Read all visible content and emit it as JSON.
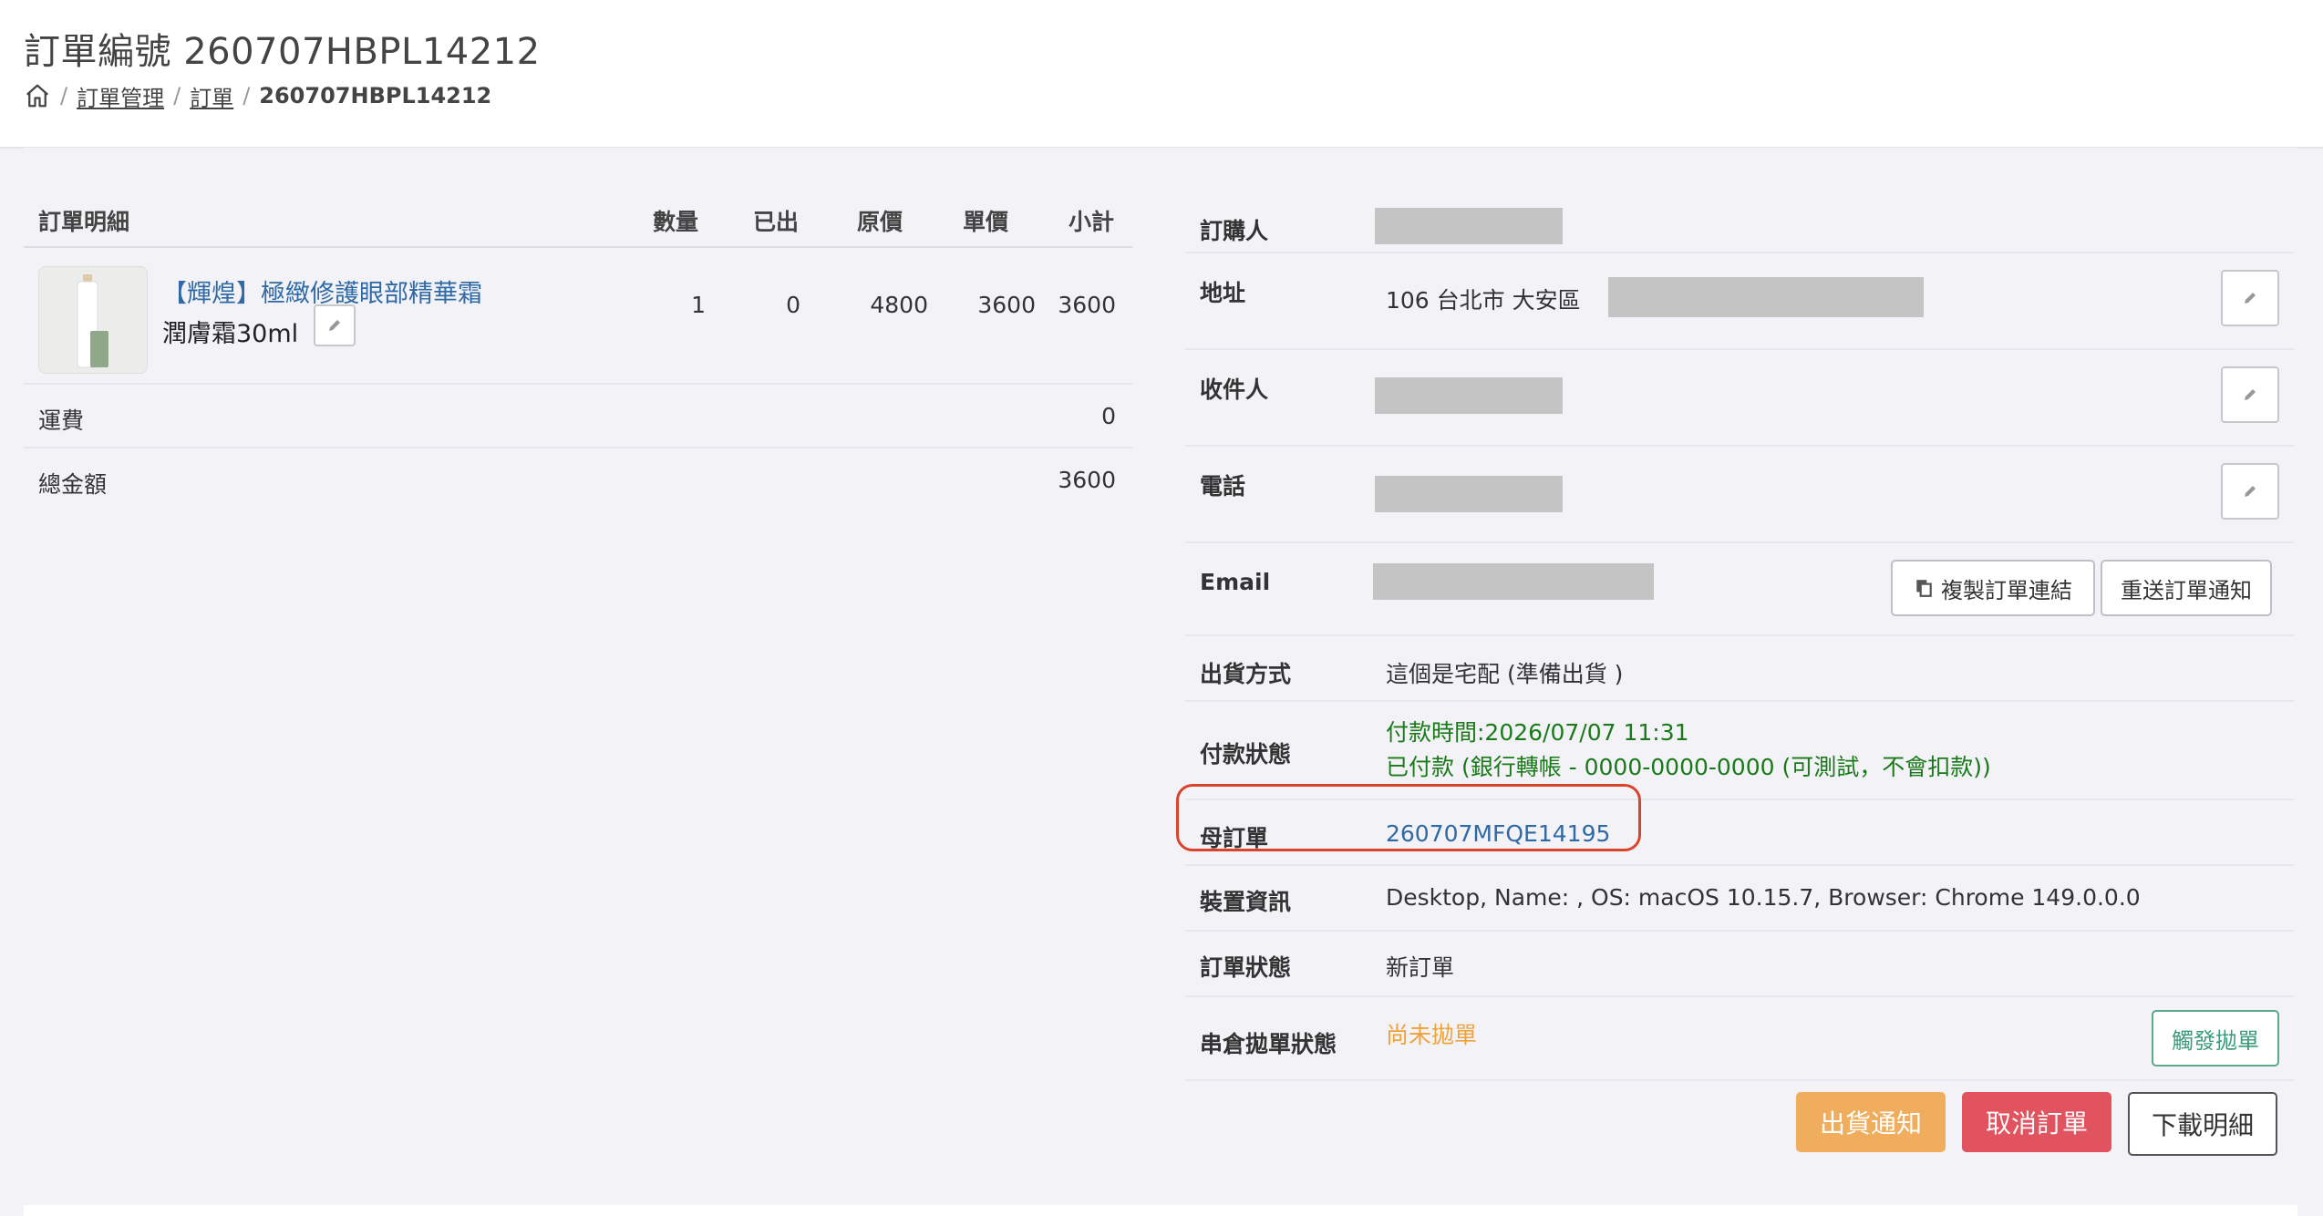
{
  "page": {
    "title": "訂單編號 260707HBPL14212"
  },
  "breadcrumb": {
    "home_icon": "home-icon",
    "items": [
      "訂單管理",
      "訂單"
    ],
    "current": "260707HBPL14212",
    "separator": "/"
  },
  "order_detail": {
    "headers": {
      "item": "訂單明細",
      "qty": "數量",
      "shipped": "已出",
      "original_price": "原價",
      "unit_price": "單價",
      "subtotal": "小計"
    },
    "products": [
      {
        "name": "【輝煌】極緻修護眼部精華霜",
        "variant": "潤膚霜30ml",
        "qty": "1",
        "shipped": "0",
        "original_price": "4800",
        "unit_price": "3600",
        "subtotal": "3600"
      }
    ],
    "shipping": {
      "label": "運費",
      "value": "0"
    },
    "total": {
      "label": "總金額",
      "value": "3600"
    }
  },
  "customer": {
    "buyer": {
      "label": "訂購人"
    },
    "address": {
      "label": "地址",
      "value": "106 台北市 大安區"
    },
    "recipient": {
      "label": "收件人"
    },
    "phone": {
      "label": "電話"
    },
    "email": {
      "label": "Email"
    },
    "copy_link_button": "複製訂單連結",
    "resend_button": "重送訂單通知",
    "shipping_method": {
      "label": "出貨方式",
      "value": "這個是宅配 (準備出貨 )"
    },
    "payment_status": {
      "label": "付款狀態",
      "time": "付款時間:2026/07/07 11:31",
      "detail": "已付款 (銀行轉帳 - 0000-0000-0000 (可測試，不會扣款))"
    },
    "parent_order": {
      "label": "母訂單",
      "value": "260707MFQE14195"
    },
    "device": {
      "label": "裝置資訊",
      "value": "Desktop, Name: , OS: macOS 10.15.7, Browser: Chrome 149.0.0.0"
    },
    "order_status": {
      "label": "訂單狀態",
      "value": "新訂單"
    },
    "warehouse_status": {
      "label": "串倉拋單狀態",
      "value": "尚未拋單",
      "button": "觸發拋單"
    }
  },
  "actions": {
    "ship_notice": "出貨通知",
    "cancel_order": "取消訂單",
    "download_detail": "下載明細"
  },
  "colors": {
    "ship_notice_bg": "#f0ad5e",
    "cancel_bg": "#e0535f",
    "link": "#2f6aa6",
    "paid": "#1a7a1a",
    "warn": "#f0a23a",
    "highlight": "#d9452c"
  }
}
